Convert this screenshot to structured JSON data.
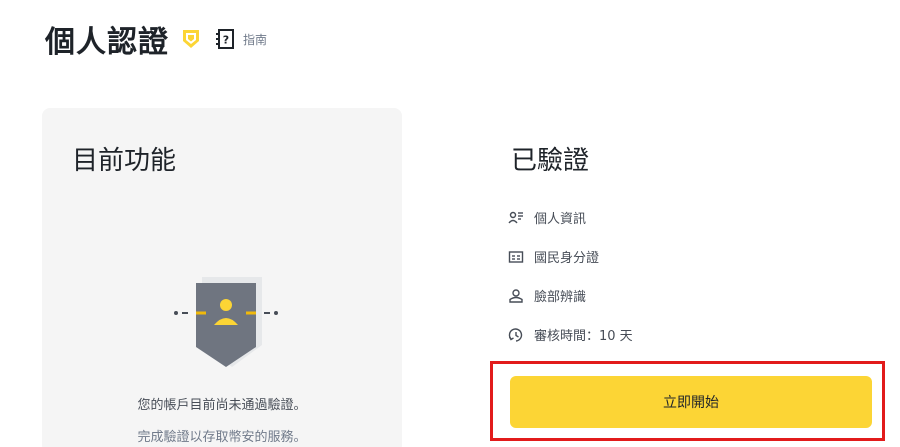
{
  "header": {
    "title": "個人認證",
    "guide_label": "指南"
  },
  "current_features": {
    "title": "目前功能",
    "message_line1": "您的帳戶目前尚未通過驗證。",
    "message_line2": "完成驗證以存取幣安的服務。"
  },
  "verified": {
    "title": "已驗證",
    "requirements": [
      {
        "icon": "personal-info-icon",
        "label": "個人資訊"
      },
      {
        "icon": "id-card-icon",
        "label": "國民身分證"
      },
      {
        "icon": "face-icon",
        "label": "臉部辨識"
      },
      {
        "icon": "clock-icon",
        "label": "審核時間：10 天"
      }
    ],
    "start_button_label": "立即開始"
  },
  "colors": {
    "accent": "#fcd535",
    "highlight": "#e21b1b",
    "card_bg": "#f5f5f5"
  }
}
